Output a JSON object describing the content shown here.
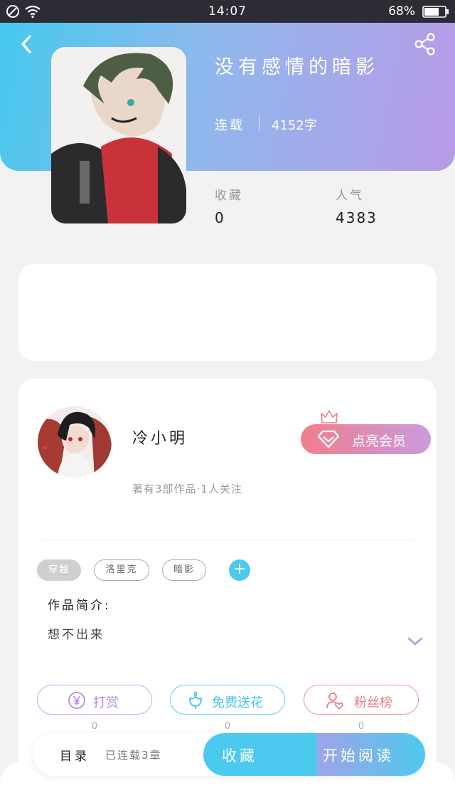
{
  "status_bar": {
    "time": "14:07",
    "battery": "68%",
    "icons": [
      "no-sim-icon",
      "wifi-icon",
      "battery-icon"
    ]
  },
  "header": {
    "back_icon": "chevron-left-icon",
    "share_icon": "share-icon"
  },
  "book": {
    "title": "没有感情的暗影",
    "status": "连载",
    "word_count": "4152字",
    "stats": [
      {
        "label": "收藏",
        "value": "0"
      },
      {
        "label": "人气",
        "value": "4383"
      }
    ]
  },
  "author": {
    "name": "冷小明",
    "meta": "著有3部作品·1人关注",
    "vip_label": "点亮会员"
  },
  "tags": [
    "穿越",
    "洛里克",
    "暗影"
  ],
  "intro": {
    "label": "作品简介:",
    "text": "想不出来"
  },
  "actions": [
    {
      "label": "打赏",
      "icon": "yen-coin-icon",
      "count": "0",
      "color": "#b38be0"
    },
    {
      "label": "免费送花",
      "icon": "flower-icon",
      "count": "0",
      "color": "#46c4e8"
    },
    {
      "label": "粉丝榜",
      "icon": "fans-icon",
      "count": "0",
      "color": "#ec7c84"
    }
  ],
  "bottom_bar": {
    "toc_label": "目录",
    "chapter_status": "已连载3章",
    "collect_label": "收藏",
    "read_label": "开始阅读"
  },
  "colors": {
    "hero_start": "#46c9ef",
    "hero_end": "#b89ae6",
    "accent_blue": "#4cc9ef",
    "vip_start": "#f07e8c",
    "vip_end": "#c99bdf"
  }
}
